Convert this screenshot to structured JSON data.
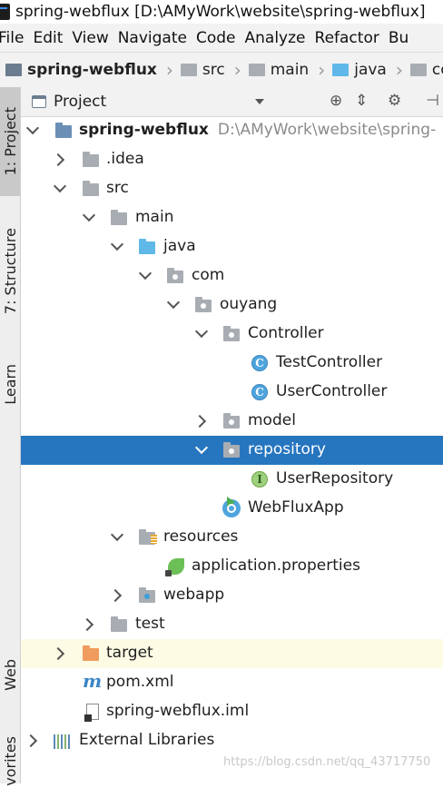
{
  "window": {
    "title": "spring-webflux [D:\\AMyWork\\website\\spring-webflux]"
  },
  "menu": [
    "File",
    "Edit",
    "View",
    "Navigate",
    "Code",
    "Analyze",
    "Refactor",
    "Bu"
  ],
  "breadcrumbs": [
    {
      "label": "spring-webflux",
      "icon": "project-folder-icon"
    },
    {
      "label": "src",
      "icon": "folder-icon"
    },
    {
      "label": "main",
      "icon": "folder-icon"
    },
    {
      "label": "java",
      "icon": "source-folder-icon"
    },
    {
      "label": "co",
      "icon": "package-icon"
    }
  ],
  "sidebar": {
    "tabs": [
      {
        "label": "1: Project",
        "active": true
      },
      {
        "label": "7: Structure",
        "active": false
      },
      {
        "label": "Learn",
        "active": false
      },
      {
        "label": "Web",
        "active": false
      },
      {
        "label": "vorites",
        "active": false
      }
    ]
  },
  "panel": {
    "title": "Project"
  },
  "tree": [
    {
      "label": "spring-webflux",
      "path": "D:\\AMyWork\\website\\spring-",
      "icon": "project-folder-icon",
      "state": "open"
    },
    {
      "label": ".idea",
      "icon": "folder-icon",
      "state": "closed"
    },
    {
      "label": "src",
      "icon": "folder-icon",
      "state": "open"
    },
    {
      "label": "main",
      "icon": "folder-icon",
      "state": "open"
    },
    {
      "label": "java",
      "icon": "source-folder-icon",
      "state": "open"
    },
    {
      "label": "com",
      "icon": "package-icon",
      "state": "open"
    },
    {
      "label": "ouyang",
      "icon": "package-icon",
      "state": "open"
    },
    {
      "label": "Controller",
      "icon": "package-icon",
      "state": "open"
    },
    {
      "label": "TestController",
      "icon": "class-icon",
      "state": "leaf"
    },
    {
      "label": "UserController",
      "icon": "class-icon",
      "state": "leaf"
    },
    {
      "label": "model",
      "icon": "package-icon",
      "state": "closed"
    },
    {
      "label": "repository",
      "icon": "package-icon",
      "state": "open",
      "selected": true
    },
    {
      "label": "UserRepository",
      "icon": "interface-icon",
      "state": "leaf"
    },
    {
      "label": "WebFluxApp",
      "icon": "spring-boot-app-icon",
      "state": "leaf"
    },
    {
      "label": "resources",
      "icon": "resources-folder-icon",
      "state": "open"
    },
    {
      "label": "application.properties",
      "icon": "spring-properties-icon",
      "state": "leaf"
    },
    {
      "label": "webapp",
      "icon": "web-folder-icon",
      "state": "closed"
    },
    {
      "label": "test",
      "icon": "folder-icon",
      "state": "closed"
    },
    {
      "label": "target",
      "icon": "excluded-folder-icon",
      "state": "closed",
      "highlight": true
    },
    {
      "label": "pom.xml",
      "icon": "maven-icon",
      "state": "leaf"
    },
    {
      "label": "spring-webflux.iml",
      "icon": "iml-file-icon",
      "state": "leaf"
    },
    {
      "label": "External Libraries",
      "icon": "libraries-icon",
      "state": "closed"
    }
  ],
  "watermark": "https://blog.csdn.net/qq_43717750",
  "colors": {
    "selection": "#2675bf",
    "highlight": "#fdfbe4",
    "folder": "#a8adb3",
    "source_folder": "#5fb8e8",
    "excluded_folder": "#f09c5e"
  }
}
